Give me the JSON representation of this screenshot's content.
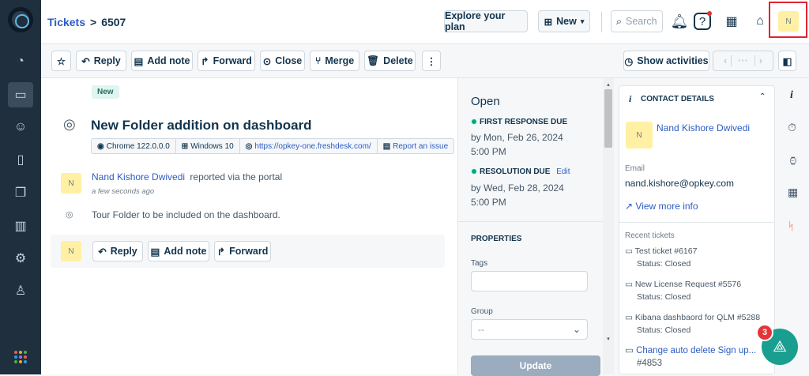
{
  "breadcrumb": {
    "parent": "Tickets",
    "separator": ">",
    "ticket_id": "6507"
  },
  "header": {
    "explore_label": "Explore your plan",
    "new_label": "New",
    "search_placeholder": "Search",
    "avatar_initial": "N",
    "notification_dot_color": "#e43538"
  },
  "toolbar": {
    "reply": "Reply",
    "add_note": "Add note",
    "forward": "Forward",
    "close": "Close",
    "merge": "Merge",
    "delete": "Delete",
    "more": "⋮",
    "show_activities": "Show activities"
  },
  "ticket": {
    "status_badge": "New",
    "subject": "New Folder addition on dashboard",
    "meta": {
      "browser": "Chrome 122.0.0.0",
      "os": "Windows 10",
      "url": "https://opkey-one.freshdesk.com/",
      "report": "Report an issue"
    },
    "requester_name": "Nand Kishore Dwivedi",
    "reported_via": "reported via the portal",
    "time": "a few seconds ago",
    "description": "Tour Folder to be included on the dashboard.",
    "requester_initial": "N"
  },
  "reply_box": {
    "reply": "Reply",
    "add_note": "Add note",
    "forward": "Forward",
    "avatar_initial": "N"
  },
  "status_panel": {
    "status": "Open",
    "first_response_label": "FIRST RESPONSE DUE",
    "first_response_value": "by Mon, Feb 26, 2024 5:00 PM",
    "resolution_label": "RESOLUTION DUE",
    "resolution_edit": "Edit",
    "resolution_value": "by Wed, Feb 28, 2024 5:00 PM",
    "properties_heading": "PROPERTIES",
    "tags_label": "Tags",
    "group_label": "Group",
    "group_value": "--",
    "update_label": "Update"
  },
  "contact": {
    "heading": "CONTACT DETAILS",
    "name": "Nand Kishore Dwivedi",
    "avatar_initial": "N",
    "email_label": "Email",
    "email": "nand.kishore@opkey.com",
    "view_more": "View more info",
    "recent_label": "Recent tickets",
    "recent": [
      {
        "title": "Test ticket #6167",
        "status": "Status: Closed"
      },
      {
        "title": "New License Request #5576",
        "status": "Status: Closed"
      },
      {
        "title": "Kibana dashbaord for QLM #5288",
        "status": "Status: Closed"
      },
      {
        "title": "Change auto delete Sign up...",
        "id": "#4853"
      }
    ]
  },
  "fab": {
    "badge": "3"
  },
  "colors": {
    "accent": "#2c5cc5",
    "sidebar": "#1f2f3d",
    "open_green": "#00a886",
    "fab": "#1a9e8f",
    "highlight": "#e0242f"
  }
}
